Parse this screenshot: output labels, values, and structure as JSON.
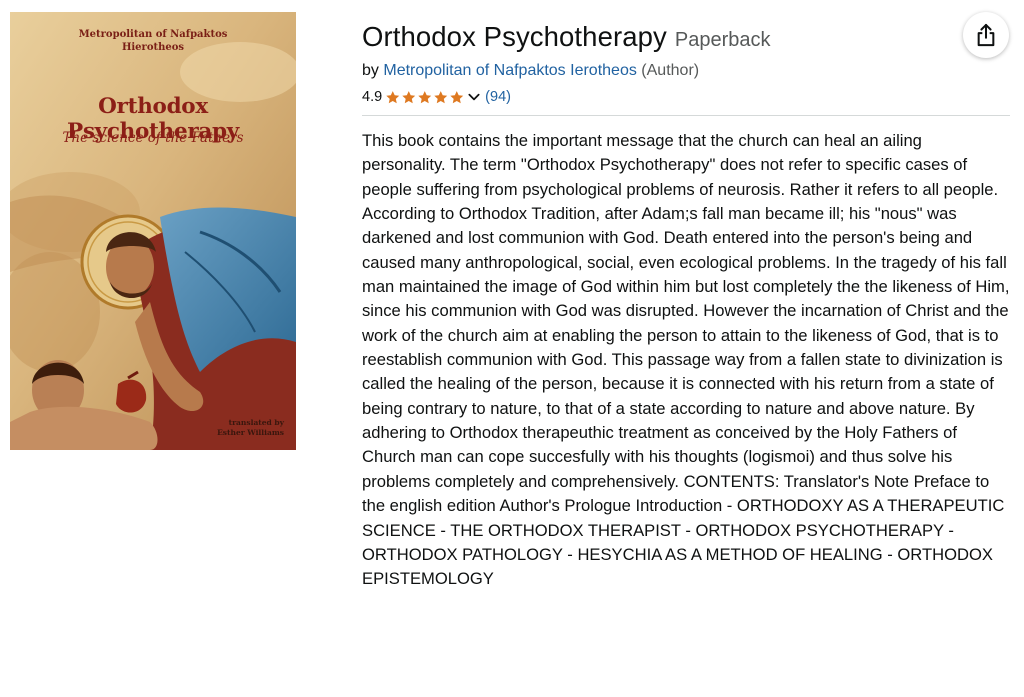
{
  "cover": {
    "author_line1": "Metropolitan of Nafpaktos",
    "author_line2": "Hierotheos",
    "title": "Orthodox Psychotherapy",
    "subtitle": "The science of the Fathers",
    "translator_line1": "translated by",
    "translator_line2": "Esther Williams"
  },
  "product": {
    "title": "Orthodox Psychotherapy",
    "format": "Paperback",
    "by_label": "by",
    "author": "Metropolitan of Nafpaktos Ierotheos",
    "author_role": "(Author)",
    "rating": "4.9",
    "stars_filled": 5,
    "review_count": "(94)",
    "description": "This book contains the important message that the church can heal an ailing personality. The term \"Orthodox Psychotherapy\" does not refer to specific cases of people suffering from psychological problems of neurosis. Rather it refers to all people. According to Orthodox Tradition, after Adam;s fall man became ill; his \"nous\" was darkened and lost communion with God. Death entered into the person's being and caused many anthropological, social, even ecological problems. In the tragedy of his fall man maintained the image of God within him but lost completely the the likeness of Him, since his communion with God was disrupted. However the incarnation of Christ and the work of the church aim at enabling the person to attain to the likeness of God, that is to reestablish communion with God. This passage way from a fallen state to divinization is called the healing of the person, because it is connected with his return from a state of being contrary to nature, to that of a state according to nature and above nature. By adhering to Orthodox therapeuthic treatment as conceived by the Holy Fathers of Church man can cope succesfully with his thoughts (logismoi) and thus solve his problems completely and comprehensively. CONTENTS: Translator's Note Preface to the english edition Author's Prologue Introduction - ORTHODOXY AS A THERAPEUTIC SCIENCE - THE ORTHODOX THERAPIST - ORTHODOX PSYCHOTHERAPY - ORTHODOX PATHOLOGY - HESYCHIA AS A METHOD OF HEALING - ORTHODOX EPISTEMOLOGY"
  },
  "icons": {
    "share": "share-icon",
    "star": "star-icon",
    "chevron": "chevron-down-icon"
  },
  "colors": {
    "link": "#2162a1",
    "star": "#de7921",
    "text": "#0f1111",
    "muted": "#565959"
  }
}
